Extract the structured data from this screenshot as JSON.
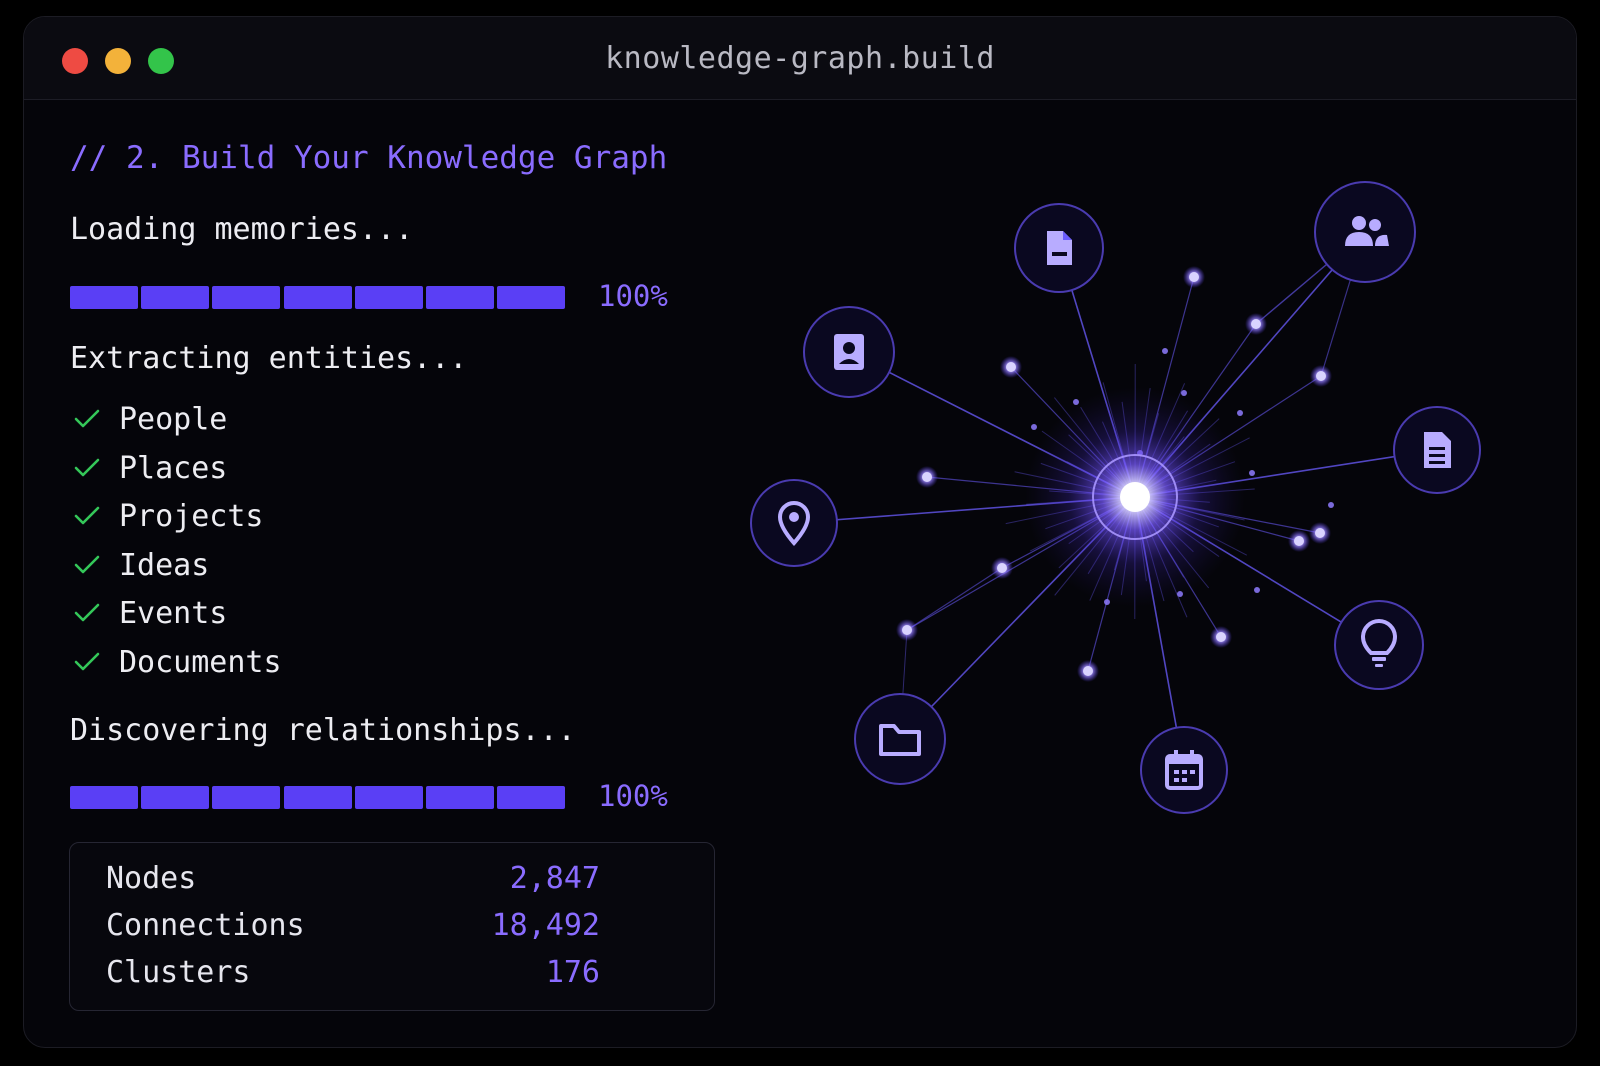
{
  "window": {
    "title": "knowledge-graph.build"
  },
  "heading": "// 2. Build Your Knowledge Graph",
  "loading": {
    "label": "Loading memories...",
    "percent": "100%",
    "progress": 1.0,
    "segments": 7
  },
  "extracting": {
    "label": "Extracting entities...",
    "items": [
      "People",
      "Places",
      "Projects",
      "Ideas",
      "Events",
      "Documents"
    ]
  },
  "relationships": {
    "label": "Discovering relationships...",
    "percent": "100%",
    "progress": 1.0,
    "segments": 7
  },
  "stats": [
    {
      "label": "Nodes",
      "value": "2,847"
    },
    {
      "label": "Connections",
      "value": "18,492"
    },
    {
      "label": "Clusters",
      "value": "176"
    }
  ],
  "colors": {
    "accent": "#8a6cff",
    "bar": "#5a3ff5",
    "check": "#34c759",
    "node": "#6b5cff"
  },
  "graph": {
    "icons": [
      "document-icon",
      "people-icon",
      "contact-icon",
      "file-text-icon",
      "location-pin-icon",
      "lightbulb-icon",
      "folder-icon",
      "calendar-icon"
    ]
  }
}
